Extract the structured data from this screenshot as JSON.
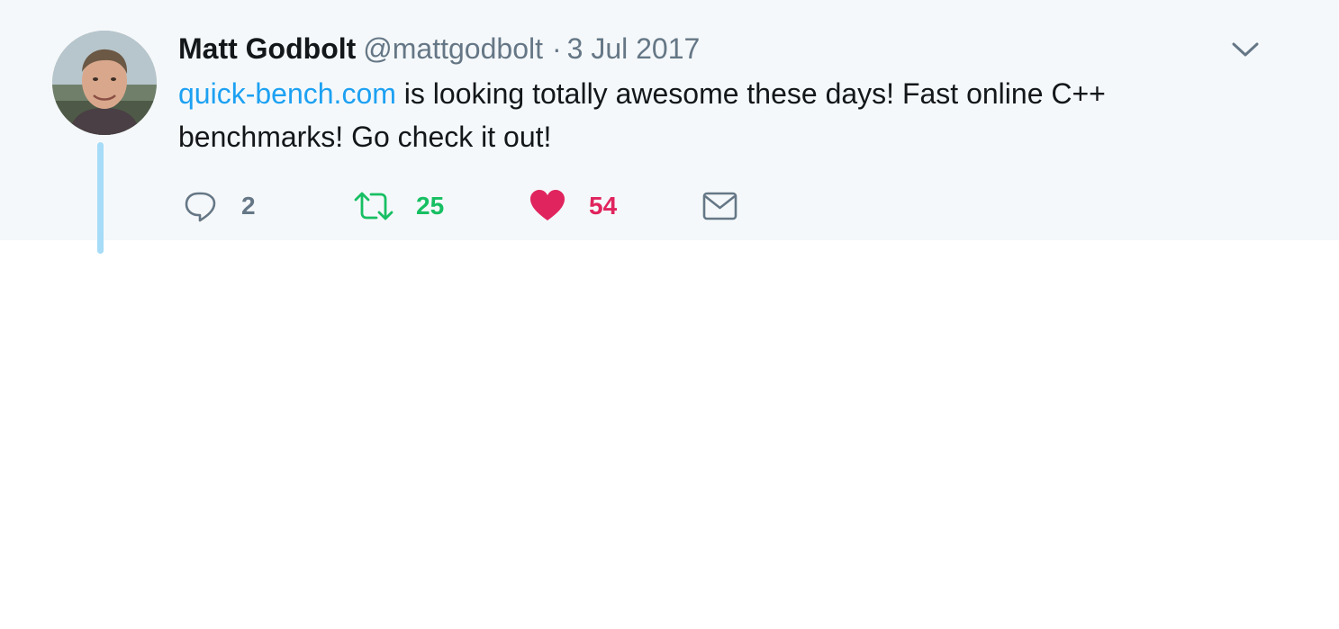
{
  "tweet": {
    "author_name": "Matt Godbolt",
    "handle": "@mattgodbolt",
    "separator": "·",
    "date": "3 Jul 2017",
    "link_text": "quick-bench.com",
    "body_text": " is looking totally awesome these days! Fast online C++ benchmarks! Go check it out!",
    "reply_count": "2",
    "retweet_count": "25",
    "like_count": "54"
  },
  "colors": {
    "background": "#f5f8fa",
    "link": "#1da1f2",
    "retweet": "#17bf63",
    "like": "#e0245e",
    "muted": "#657786",
    "thread_line": "#a6dcf7"
  },
  "icons": {
    "reply": "speech-bubble-icon",
    "retweet": "retweet-arrows-icon",
    "like": "heart-icon",
    "dm": "envelope-icon",
    "menu": "chevron-down-icon"
  }
}
